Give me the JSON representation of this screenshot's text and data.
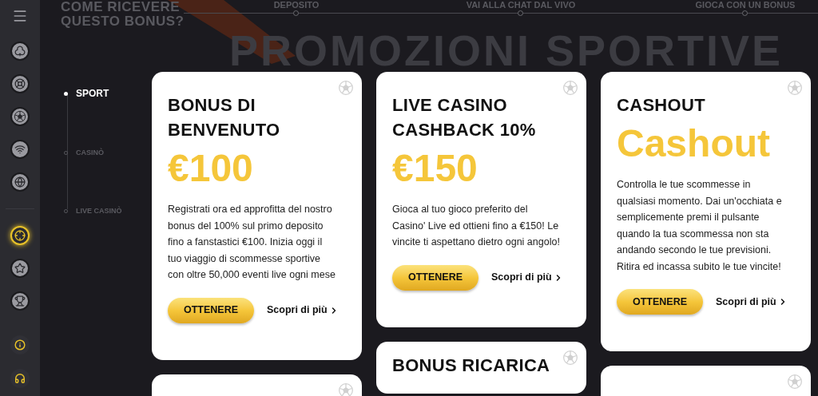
{
  "header": {
    "question_lines": [
      "COME RICEVERE",
      "QUESTO BONUS?"
    ],
    "steps": [
      "DEPOSITO",
      "VAI ALLA CHAT DAL VIVO",
      "GIOCA CON UN BONUS"
    ],
    "title": "PROMOZIONI SPORTIVE"
  },
  "sidebar": {
    "items": [
      {
        "kind": "club",
        "selected": false
      },
      {
        "kind": "wheel",
        "selected": false
      },
      {
        "kind": "ball",
        "selected": false
      },
      {
        "kind": "wifi",
        "selected": false
      },
      {
        "kind": "globe",
        "selected": false
      },
      {
        "kind": "divider"
      },
      {
        "kind": "crosshair",
        "selected": true
      },
      {
        "kind": "star",
        "selected": false
      },
      {
        "kind": "trophy",
        "selected": false
      }
    ],
    "bottom": [
      {
        "kind": "info"
      },
      {
        "kind": "headset"
      }
    ]
  },
  "nav": [
    {
      "label": "SPORT",
      "selected": true
    },
    {
      "label": "CASINÒ",
      "selected": false
    },
    {
      "label": "LIVE CASINÒ",
      "selected": false
    }
  ],
  "columns": [
    [
      {
        "title": "BONUS DI BENVENUTO",
        "amount": "€100",
        "text": "Registrati ora ed approfitta del nostro bonus del 100% sul primo deposito fino a fanstastici €100. Inizia oggi il tuo viaggio di scommesse sportive con oltre 50,000 eventi live ogni mese",
        "button": "OTTENERE",
        "link": "Scopri di più"
      },
      {}
    ],
    [
      {
        "title": "LIVE CASINO CASHBACK 10%",
        "amount": "€150",
        "text": "Gioca al tuo gioco preferito del Casino' Live ed ottieni fino a €150! Le vincite ti aspettano dietro ogni angolo!",
        "button": "OTTENERE",
        "link": "Scopri di più"
      },
      {
        "title": "BONUS RICARICA"
      }
    ],
    [
      {
        "title": "CASHOUT",
        "amount": "Cashout",
        "text": "Controlla le tue scommesse in qualsiasi momento. Dai un'occhiata e semplicemente premi il pulsante quando la tua scommessa non sta andando secondo le tue previsioni. Ritira ed incassa subito le tue vincite!",
        "button": "OTTENERE",
        "link": "Scopri di più"
      },
      {}
    ]
  ]
}
